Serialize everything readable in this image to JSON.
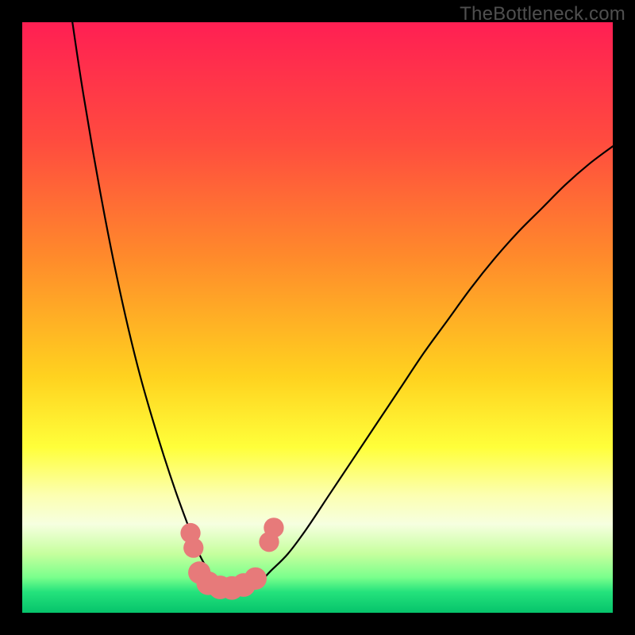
{
  "watermark": "TheBottleneck.com",
  "chart_data": {
    "type": "line",
    "title": "",
    "xlabel": "",
    "ylabel": "",
    "xlim": [
      0,
      100
    ],
    "ylim": [
      0,
      100
    ],
    "grid": false,
    "legend": false,
    "gradient_stops": [
      {
        "offset": 0.0,
        "color": "#ff1f53"
      },
      {
        "offset": 0.2,
        "color": "#ff4b3f"
      },
      {
        "offset": 0.4,
        "color": "#ff8b2b"
      },
      {
        "offset": 0.6,
        "color": "#ffd21f"
      },
      {
        "offset": 0.72,
        "color": "#ffff3a"
      },
      {
        "offset": 0.8,
        "color": "#fcffb0"
      },
      {
        "offset": 0.85,
        "color": "#f6ffe0"
      },
      {
        "offset": 0.9,
        "color": "#c6ff9e"
      },
      {
        "offset": 0.94,
        "color": "#7aff8c"
      },
      {
        "offset": 0.965,
        "color": "#24e27c"
      },
      {
        "offset": 1.0,
        "color": "#06c36b"
      }
    ],
    "series": [
      {
        "name": "bottleneck-curve",
        "stroke": "#000000",
        "x": [
          8.5,
          10,
          12,
          14,
          16,
          18,
          20,
          22,
          24,
          26,
          28,
          29.5,
          31,
          32.5,
          34,
          36,
          38,
          40,
          42,
          45,
          48,
          52,
          56,
          60,
          64,
          68,
          72,
          76,
          80,
          84,
          88,
          92,
          96,
          100
        ],
        "y": [
          100,
          90,
          78,
          67,
          57,
          48,
          40,
          33,
          26.5,
          20.5,
          15,
          11,
          8,
          6,
          4.8,
          4.2,
          4.3,
          5,
          7,
          10,
          14,
          20,
          26,
          32,
          38,
          44,
          49.5,
          55,
          60,
          64.5,
          68.5,
          72.5,
          76,
          79
        ]
      }
    ],
    "marker_series": {
      "name": "trough-points",
      "color": "#e77a7a",
      "points": [
        {
          "x": 28.5,
          "y": 13.5,
          "r": 1.7
        },
        {
          "x": 29.0,
          "y": 11.0,
          "r": 1.7
        },
        {
          "x": 30.0,
          "y": 6.8,
          "r": 1.9
        },
        {
          "x": 31.5,
          "y": 5.0,
          "r": 2.0
        },
        {
          "x": 33.5,
          "y": 4.3,
          "r": 2.0
        },
        {
          "x": 35.5,
          "y": 4.2,
          "r": 2.0
        },
        {
          "x": 37.5,
          "y": 4.7,
          "r": 2.0
        },
        {
          "x": 39.5,
          "y": 5.8,
          "r": 1.9
        },
        {
          "x": 41.8,
          "y": 12.0,
          "r": 1.7
        },
        {
          "x": 42.6,
          "y": 14.4,
          "r": 1.7
        }
      ]
    }
  }
}
